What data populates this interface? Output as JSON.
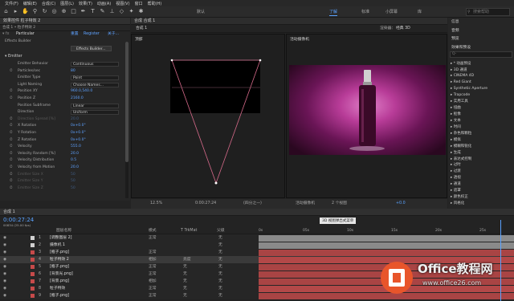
{
  "menu": [
    "文件(F)",
    "编辑(E)",
    "合成(C)",
    "图层(L)",
    "效果(T)",
    "动画(A)",
    "视图(V)",
    "窗口",
    "帮助(H)"
  ],
  "workspaces": {
    "default": "默认",
    "learn": "了解",
    "standard": "标准",
    "small": "小屏幕",
    "library": "库"
  },
  "search_placeholder": "搜索帮助",
  "left": {
    "tab": "效果控件 粒子特效 2",
    "breadcrumb": "合成 1 • 粒子特效 2",
    "effect_name": "Particular",
    "reset": "重置",
    "register": "Register",
    "about": "关于...",
    "effects_builder_label": "Effects Builder",
    "effects_builder_btn": "Effects Builder...",
    "emitter": "Emitter",
    "rows": [
      {
        "label": "Emitter Behavior",
        "dd": "Continuous"
      },
      {
        "label": "Particles/sec",
        "val": "80"
      },
      {
        "label": "Emitter Type",
        "dd": "Point"
      },
      {
        "label": "Light Naming",
        "dd": "Choose Names..."
      },
      {
        "label": "Position XY",
        "val": "960.0,540.0"
      },
      {
        "label": "Position Z",
        "val": "2160.0"
      },
      {
        "label": "Position Subframe",
        "dd": "Linear"
      },
      {
        "label": "Direction",
        "dd": "Uniform"
      },
      {
        "label": "Direction Spread [%]",
        "val": "20.0",
        "dim": true
      },
      {
        "label": "X Rotation",
        "val": "0x+0.0°"
      },
      {
        "label": "Y Rotation",
        "val": "0x+0.0°"
      },
      {
        "label": "Z Rotation",
        "val": "0x+0.0°"
      },
      {
        "label": "Velocity",
        "val": "555.0"
      },
      {
        "label": "Velocity Random [%]",
        "val": "20.0"
      },
      {
        "label": "Velocity Distribution",
        "val": "0.5"
      },
      {
        "label": "Velocity from Motion",
        "val": "20.0"
      },
      {
        "label": "Emitter Size X",
        "val": "50",
        "dim": true
      },
      {
        "label": "Emitter Size Y",
        "val": "50",
        "dim": true
      },
      {
        "label": "Emitter Size Z",
        "val": "50",
        "dim": true
      }
    ]
  },
  "comp": {
    "tab": "合成 合成 1",
    "subtab": "合成 1",
    "renderer_label": "渲染器：",
    "renderer_value": "经典 3D",
    "left_view": "顶部",
    "right_view": "活动摄像机",
    "zoom": "12.5%",
    "time": "0:00:27:24",
    "quality": "(四分之一)",
    "view_mode": "活动摄像机",
    "views": "2 个视图",
    "exposure": "+0.0"
  },
  "right_panel": {
    "items": [
      "信息",
      "音频",
      "预览",
      "效果和预设"
    ],
    "search": "Q-",
    "categories": [
      "* 动画预设",
      "3D 通道",
      "CINEMA 4D",
      "Red Giant",
      "Synthetic Aperture",
      "Trapcode",
      "实用工具",
      "扭曲",
      "抠像",
      "文本",
      "时间",
      "杂色和颗粒",
      "模拟",
      "模糊和锐化",
      "生成",
      "表达式控制",
      "过时",
      "过渡",
      "透视",
      "通道",
      "遮罩",
      "颜色校正",
      "风格化"
    ]
  },
  "timeline": {
    "tab": "合成 1",
    "timecode": "0:00:27:24",
    "fps": "00834 (25.00 fps)",
    "tooltip": "3D 视图弹出式菜单",
    "header": {
      "name": "图层名称",
      "mode": "模式",
      "trkmat": "T TrkMat",
      "parent": "父级"
    },
    "ruler": [
      "0s",
      "05s",
      "10s",
      "15s",
      "20s",
      "25s"
    ],
    "layers": [
      {
        "num": "1",
        "name": "[调整图层 2]",
        "mode": "正常",
        "trk": "",
        "parent": "无",
        "color": "#d0d0d0",
        "bar": "#8a8a8a"
      },
      {
        "num": "2",
        "name": "摄像机 1",
        "mode": "",
        "trk": "",
        "parent": "无",
        "color": "#d0d0d0",
        "bar": "#8a8a8a"
      },
      {
        "num": "3",
        "name": "[瓶子.png]",
        "mode": "正常",
        "trk": "",
        "parent": "无",
        "color": "#c64a4a",
        "bar": "#a94444"
      },
      {
        "num": "4",
        "name": "粒子特效 2",
        "mode": "相加",
        "trk": "亮度",
        "parent": "无",
        "color": "#c64a4a",
        "bar": "#b34848"
      },
      {
        "num": "5",
        "name": "[瓶子.png]",
        "mode": "正常",
        "trk": "无",
        "parent": "无",
        "color": "#c64a4a",
        "bar": "#a94444"
      },
      {
        "num": "6",
        "name": "[背景光.png]",
        "mode": "正常",
        "trk": "无",
        "parent": "无",
        "color": "#c64a4a",
        "bar": "#a94444"
      },
      {
        "num": "7",
        "name": "[背景.png]",
        "mode": "相加",
        "trk": "无",
        "parent": "无",
        "color": "#c64a4a",
        "bar": "#a94444"
      },
      {
        "num": "8",
        "name": "粒子特效",
        "mode": "正常",
        "trk": "无",
        "parent": "无",
        "color": "#c64a4a",
        "bar": "#b34848"
      },
      {
        "num": "9",
        "name": "[瓶子.png]",
        "mode": "正常",
        "trk": "无",
        "parent": "无",
        "color": "#c64a4a",
        "bar": "#a94444"
      }
    ]
  },
  "watermark": {
    "brand": "Office教程网",
    "url": "www.office26.com"
  },
  "colors": {
    "accent": "#5aa2ff",
    "layer_red": "#c64a4a",
    "magenta": "#c02a8a"
  }
}
